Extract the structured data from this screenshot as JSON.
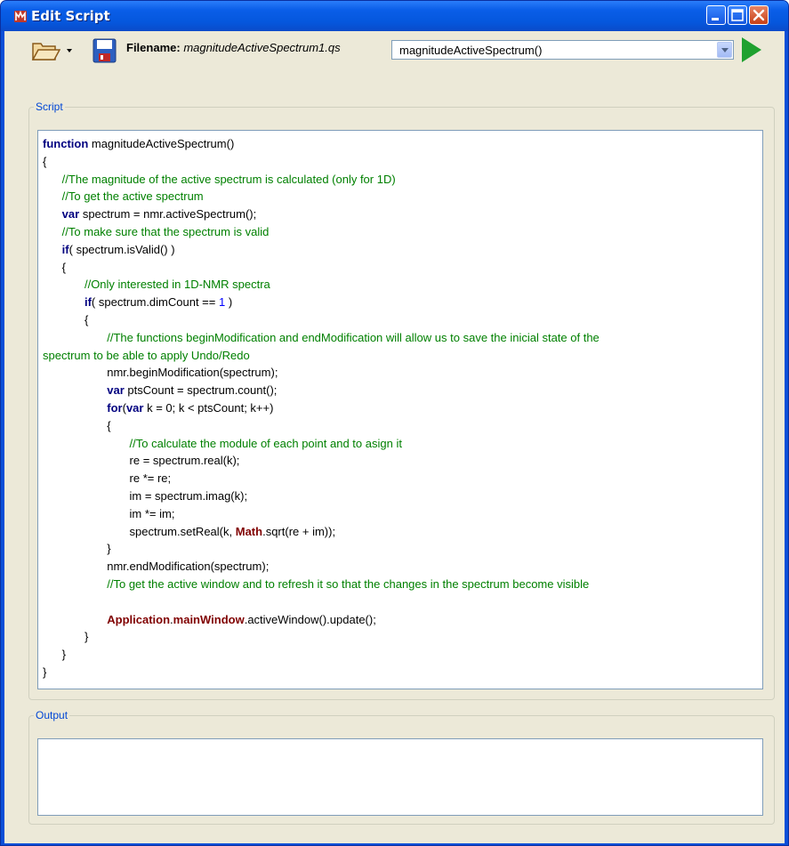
{
  "window": {
    "title": "Edit Script",
    "controls": [
      "minimize-icon",
      "maximize-icon",
      "close-icon"
    ]
  },
  "toolbar": {
    "open_icon": "folder-open-icon",
    "dropdown_icon": "chevron-down-icon",
    "save_icon": "floppy-disk-icon",
    "filename_label": "Filename:",
    "filename_value": "magnitudeActiveSpectrum1.qs",
    "function_select_value": "magnitudeActiveSpectrum()",
    "run_icon": "play-icon",
    "run_color": "#1fa12f"
  },
  "script_panel": {
    "legend": "Script",
    "lines": [
      [
        {
          "t": "kw",
          "v": "function"
        },
        {
          "t": "pl",
          "v": " magnitudeActiveSpectrum()"
        }
      ],
      [
        {
          "t": "pl",
          "v": "{"
        }
      ],
      [
        {
          "t": "pl",
          "v": "      "
        },
        {
          "t": "cm",
          "v": "//The magnitude of the active spectrum is calculated (only for 1D)"
        }
      ],
      [
        {
          "t": "pl",
          "v": "      "
        },
        {
          "t": "cm",
          "v": "//To get the active spectrum"
        }
      ],
      [
        {
          "t": "pl",
          "v": "      "
        },
        {
          "t": "kw",
          "v": "var"
        },
        {
          "t": "pl",
          "v": " spectrum = nmr.activeSpectrum();"
        }
      ],
      [
        {
          "t": "pl",
          "v": "      "
        },
        {
          "t": "cm",
          "v": "//To make sure that the spectrum is valid"
        }
      ],
      [
        {
          "t": "pl",
          "v": "      "
        },
        {
          "t": "kw",
          "v": "if"
        },
        {
          "t": "pl",
          "v": "( spectrum.isValid() )"
        }
      ],
      [
        {
          "t": "pl",
          "v": "      {"
        }
      ],
      [
        {
          "t": "pl",
          "v": "             "
        },
        {
          "t": "cm",
          "v": "//Only interested in 1D-NMR spectra"
        }
      ],
      [
        {
          "t": "pl",
          "v": "             "
        },
        {
          "t": "kw",
          "v": "if"
        },
        {
          "t": "pl",
          "v": "( spectrum.dimCount == "
        },
        {
          "t": "num",
          "v": "1"
        },
        {
          "t": "pl",
          "v": " )"
        }
      ],
      [
        {
          "t": "pl",
          "v": "             {"
        }
      ],
      [
        {
          "t": "pl",
          "v": "                    "
        },
        {
          "t": "cm",
          "v": "//The functions beginModification and endModification will allow us to save the inicial state of the"
        }
      ],
      [
        {
          "t": "cm",
          "v": "spectrum to be able to apply Undo/Redo"
        }
      ],
      [
        {
          "t": "pl",
          "v": "                    nmr.beginModification(spectrum);"
        }
      ],
      [
        {
          "t": "pl",
          "v": "                    "
        },
        {
          "t": "kw",
          "v": "var"
        },
        {
          "t": "pl",
          "v": " ptsCount = spectrum.count();"
        }
      ],
      [
        {
          "t": "pl",
          "v": "                    "
        },
        {
          "t": "kw",
          "v": "for"
        },
        {
          "t": "pl",
          "v": "("
        },
        {
          "t": "kw",
          "v": "var"
        },
        {
          "t": "pl",
          "v": " k = 0; k < ptsCount; k++)"
        }
      ],
      [
        {
          "t": "pl",
          "v": "                    {"
        }
      ],
      [
        {
          "t": "pl",
          "v": "                           "
        },
        {
          "t": "cm",
          "v": "//To calculate the module of each point and to asign it"
        }
      ],
      [
        {
          "t": "pl",
          "v": "                           re = spectrum.real(k);"
        }
      ],
      [
        {
          "t": "pl",
          "v": "                           re *= re;"
        }
      ],
      [
        {
          "t": "pl",
          "v": "                           im = spectrum.imag(k);"
        }
      ],
      [
        {
          "t": "pl",
          "v": "                           im *= im;"
        }
      ],
      [
        {
          "t": "pl",
          "v": "                           spectrum.setReal(k, "
        },
        {
          "t": "cls",
          "v": "Math"
        },
        {
          "t": "pl",
          "v": ".sqrt(re + im));"
        }
      ],
      [
        {
          "t": "pl",
          "v": "                    }"
        }
      ],
      [
        {
          "t": "pl",
          "v": "                    nmr.endModification(spectrum);"
        }
      ],
      [
        {
          "t": "pl",
          "v": "                    "
        },
        {
          "t": "cm",
          "v": "//To get the active window and to refresh it so that the changes in the spectrum become visible"
        }
      ],
      [],
      [
        {
          "t": "pl",
          "v": "                    "
        },
        {
          "t": "cls",
          "v": "Application"
        },
        {
          "t": "pl",
          "v": "."
        },
        {
          "t": "cls",
          "v": "mainWindow"
        },
        {
          "t": "pl",
          "v": ".activeWindow().update();"
        }
      ],
      [
        {
          "t": "pl",
          "v": "             }"
        }
      ],
      [
        {
          "t": "pl",
          "v": "      }"
        }
      ],
      [
        {
          "t": "pl",
          "v": "}"
        }
      ]
    ]
  },
  "output_panel": {
    "legend": "Output",
    "text": ""
  }
}
